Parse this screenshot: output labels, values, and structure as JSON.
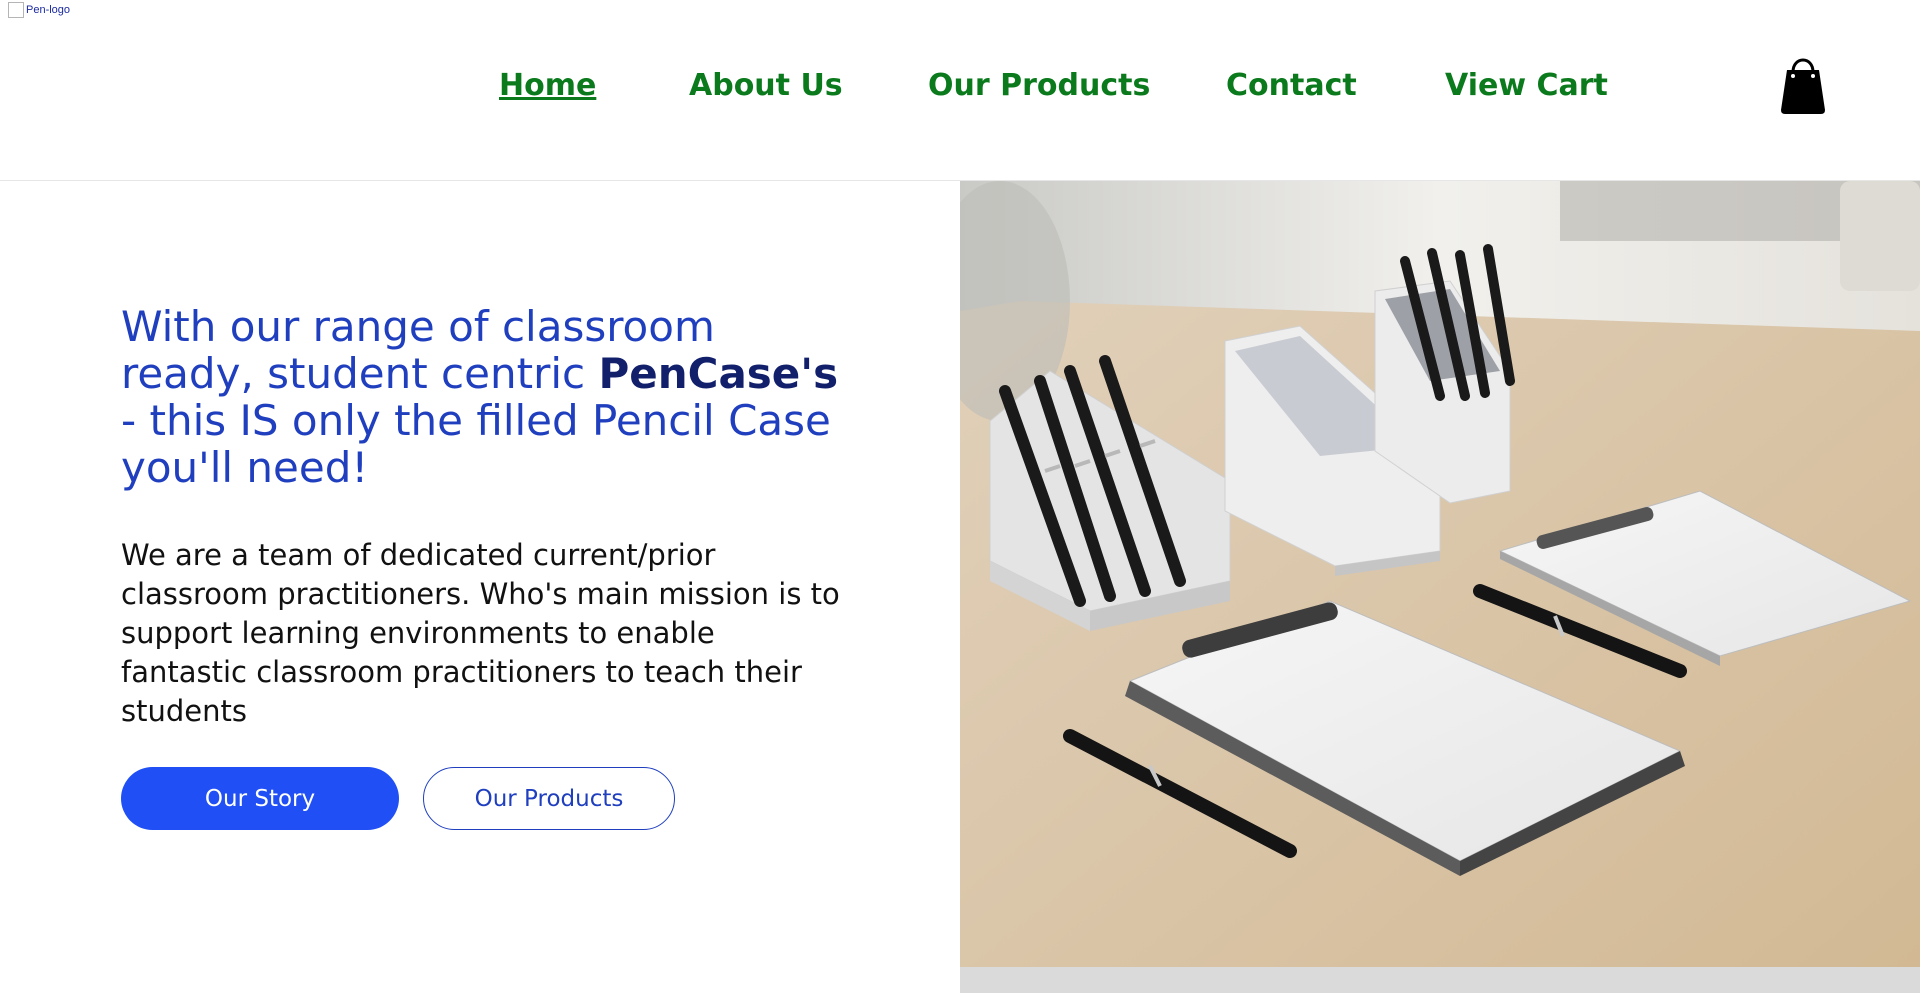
{
  "logo": {
    "alt": "Pen-logo"
  },
  "nav": {
    "home": "Home",
    "about": "About Us",
    "products": "Our Products",
    "contact": "Contact",
    "cart": "View Cart"
  },
  "cart_icon": "shopping-bag-icon",
  "hero": {
    "headline_start": "With our range of classroom ready, student centric ",
    "headline_brand": "PenCase's",
    "headline_end": " - this IS only the filled Pencil Case you'll need!",
    "intro": "We are a team of dedicated current/prior classroom practitioners. Who's main mission is to support learning environments to enable fantastic classroom practitioners to teach their students",
    "primary_button": "Our Story",
    "secondary_button": "Our Products"
  },
  "colors": {
    "nav_text": "#0b7a1d",
    "headline": "#1f3fbf",
    "brand": "#12206b",
    "primary_button": "#1f4ff5"
  }
}
